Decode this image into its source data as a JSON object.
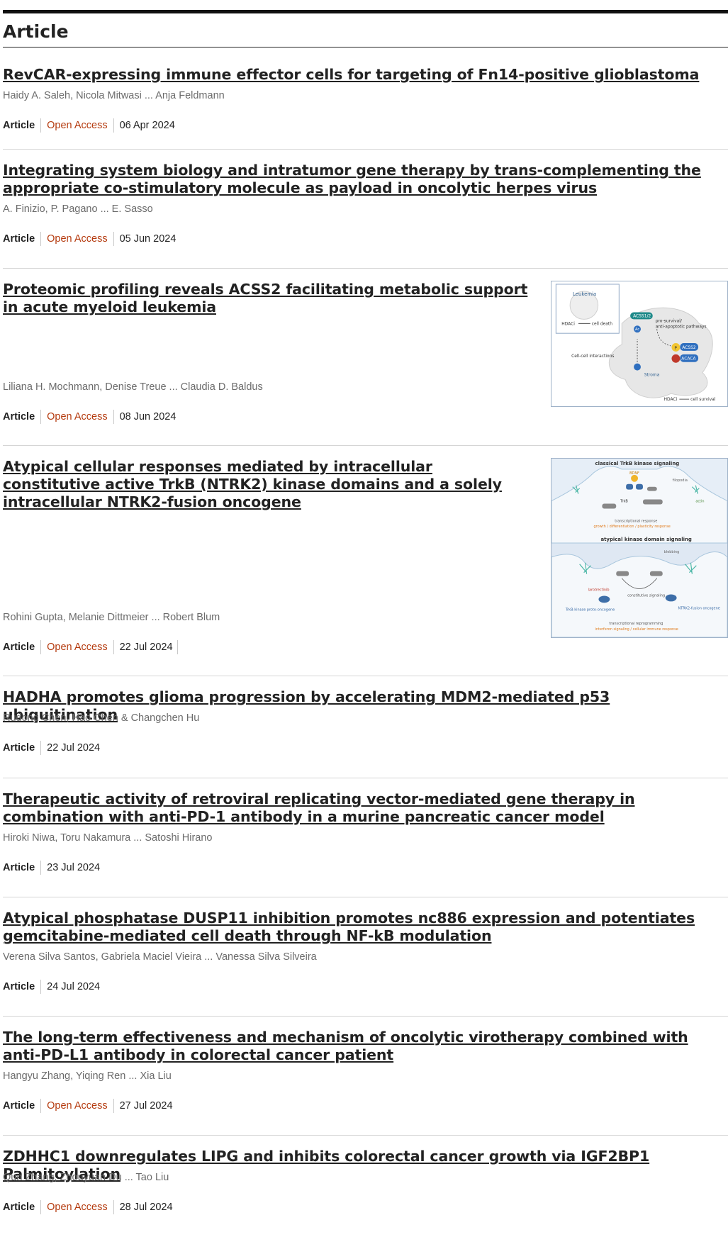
{
  "section": {
    "title": "Article"
  },
  "articles": [
    {
      "title": "RevCAR-expressing immune effector cells for targeting of Fn14-positive glioblastoma",
      "authors": "Haidy A. Saleh, Nicola Mitwasi ... Anja Feldmann",
      "type": "Article",
      "open_access": "Open Access",
      "date": "06 Apr 2024"
    },
    {
      "title": "Integrating system biology and intratumor gene therapy by trans-complementing the appropriate co-stimulatory molecule as payload in oncolytic herpes virus",
      "authors": "A. Finizio, P. Pagano ... E. Sasso",
      "type": "Article",
      "open_access": "Open Access",
      "date": "05 Jun 2024"
    },
    {
      "title": "Proteomic profiling reveals ACSS2 facilitating metabolic support in acute myeloid leukemia",
      "authors": "Liliana H. Mochmann, Denise Treue ... Claudia D. Baldus",
      "type": "Article",
      "open_access": "Open Access",
      "date": "08 Jun 2024",
      "figure": {
        "labels": [
          "Leukemia",
          "HDACi",
          "cell death",
          "ACSS1/2",
          "pro-survival/",
          "anti-apoptotic pathways",
          "Ac",
          "P",
          "ACSS2",
          "ACACA",
          "Cell-cell interactions",
          "Stroma",
          "HDACi",
          "cell survival"
        ]
      }
    },
    {
      "title": "Atypical cellular responses mediated by intracellular constitutive active TrkB (NTRK2) kinase domains and a solely intracellular NTRK2-fusion oncogene",
      "authors": "Rohini Gupta, Melanie Dittmeier ... Robert Blum",
      "type": "Article",
      "open_access": "Open Access",
      "date": "22 Jul 2024",
      "figure": {
        "labels": [
          "classical TrkB kinase signaling",
          "BDNF",
          "TrkB",
          "filopodia",
          "actin",
          "transcriptional response",
          "growth / differentiation / plasticity response",
          "atypical kinase domain signaling",
          "blebbing",
          "larotrectinib",
          "constitutive signaling",
          "TrkB-kinase proto-oncogene",
          "NTRK2-fusion oncogene",
          "transcriptional reprogramming",
          "interferon signaling / cellular immune response"
        ]
      }
    },
    {
      "title": "HADHA promotes glioma progression by accelerating MDM2-mediated p53 ubiquitination",
      "authors": "Rudong Chen, Hao Chen & Changchen Hu",
      "type": "Article",
      "date": "22 Jul 2024"
    },
    {
      "title": "Therapeutic activity of retroviral replicating vector-mediated gene therapy in combination with anti-PD-1 antibody in a murine pancreatic cancer model",
      "authors": "Hiroki Niwa, Toru Nakamura ... Satoshi Hirano",
      "type": "Article",
      "date": "23 Jul 2024"
    },
    {
      "title": "Atypical phosphatase DUSP11 inhibition promotes nc886 expression and potentiates gemcitabine-mediated cell death through NF-kB modulation",
      "authors": "Verena Silva Santos, Gabriela Maciel Vieira ... Vanessa Silva Silveira",
      "type": "Article",
      "date": "24 Jul 2024"
    },
    {
      "title": "The long-term effectiveness and mechanism of oncolytic virotherapy combined with anti-PD-L1 antibody in colorectal cancer patient",
      "authors": "Hangyu Zhang, Yiqing Ren ... Xia Liu",
      "type": "Article",
      "open_access": "Open Access",
      "date": "27 Jul 2024"
    },
    {
      "title": "ZDHHC1 downregulates LIPG and inhibits colorectal cancer growth via IGF2BP1 Palmitoylation",
      "authors": "Qun Zhang, Zhouyuan Du ... Tao Liu",
      "type": "Article",
      "open_access": "Open Access",
      "date": "28 Jul 2024"
    }
  ],
  "colors": {
    "open_access": "#b53b0f",
    "text": "#222222",
    "muted": "#6b6b6b"
  }
}
